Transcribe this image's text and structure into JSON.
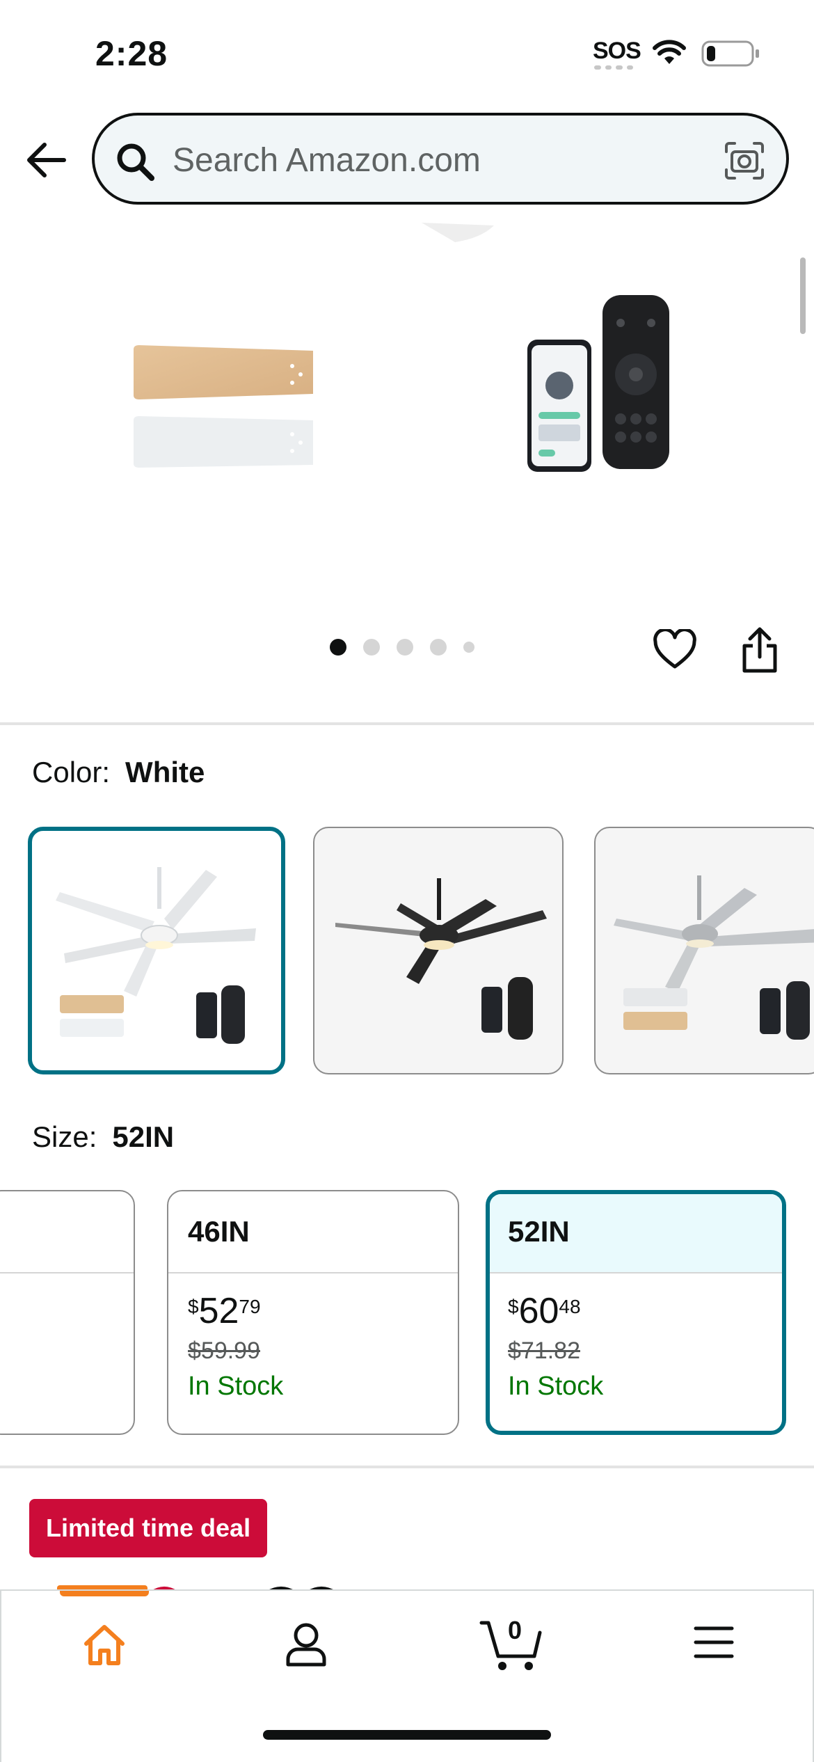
{
  "status_bar": {
    "time": "2:28",
    "sos": "SOS",
    "battery_level": 0.2
  },
  "header": {
    "search_placeholder": "Search Amazon.com",
    "icons": [
      "back-arrow-icon",
      "search-icon",
      "camera-icon"
    ]
  },
  "gallery": {
    "dot_count": 5,
    "active_index": 0,
    "actions": [
      "heart-icon",
      "share-icon"
    ]
  },
  "color": {
    "label": "Color:",
    "selected": "White",
    "options": [
      {
        "name": "White",
        "selected": true
      },
      {
        "name": "Black",
        "selected": false
      },
      {
        "name": "Nickel",
        "selected": false
      }
    ]
  },
  "size": {
    "label": "Size:",
    "selected": "52IN",
    "options": [
      {
        "label": "",
        "price_symbol": "",
        "price_whole": "",
        "price_fraction": "",
        "list_price": "",
        "stock": ""
      },
      {
        "label": "46IN",
        "price_symbol": "$",
        "price_whole": "52",
        "price_fraction": "79",
        "list_price": "$59.99",
        "stock": "In Stock"
      },
      {
        "label": "52IN",
        "price_symbol": "$",
        "price_whole": "60",
        "price_fraction": "48",
        "list_price": "$71.82",
        "stock": "In Stock"
      }
    ]
  },
  "deal": {
    "badge": "Limited time deal"
  },
  "bottom_nav": {
    "items": [
      "home-icon",
      "account-icon",
      "cart-icon",
      "menu-icon"
    ],
    "cart_count": "0",
    "active": "home"
  },
  "colors": {
    "accent": "#007185",
    "deal_red": "#cc0c39",
    "in_stock_green": "#007600",
    "nav_active_orange": "#f47f1e"
  }
}
